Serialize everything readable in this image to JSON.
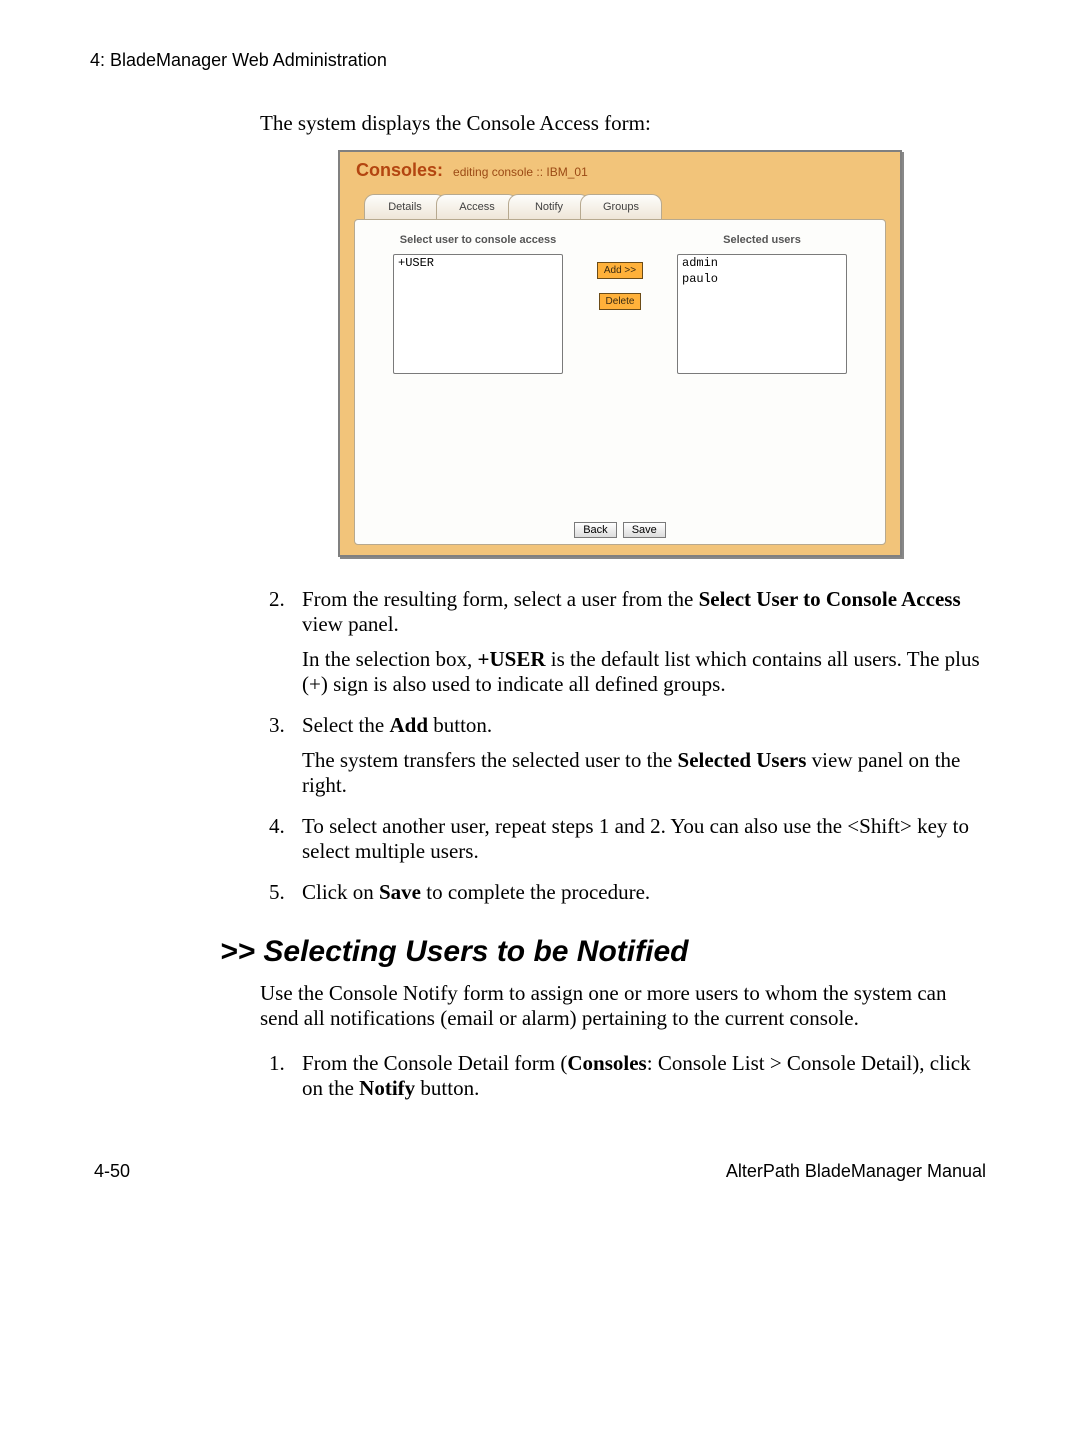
{
  "header": {
    "running": "4: BladeManager Web Administration"
  },
  "intro_line": "The system displays the Console Access form:",
  "card": {
    "title": "Consoles:",
    "subtitle": "editing console  ::  IBM_01",
    "tabs": [
      "Details",
      "Access",
      "Notify",
      "Groups"
    ],
    "left_heading": "Select user to console access",
    "right_heading": "Selected users",
    "left_options": [
      "+USER"
    ],
    "right_options": [
      "admin",
      "paulo"
    ],
    "btn_add": "Add >>",
    "btn_delete": "Delete",
    "btn_back": "Back",
    "btn_save": "Save"
  },
  "steps_a": [
    {
      "n": "2.",
      "main_pre": "From the resulting form, select a user from the ",
      "main_bold": "Select User to Console Access",
      "main_post": " view panel.",
      "sub_pre": "In the selection box, ",
      "sub_bold": "+USER",
      "sub_post": " is the default list which contains all users. The plus (+) sign is also used to indicate all defined groups."
    },
    {
      "n": "3.",
      "main_pre": "Select the ",
      "main_bold": "Add",
      "main_post": " button.",
      "sub_pre": "The system transfers the selected user to the ",
      "sub_bold": "Selected Users",
      "sub_post": " view panel on the right."
    },
    {
      "n": "4.",
      "main_pre": "To select another user, repeat steps 1 and 2. You can also use the <Shift> key to select multiple users.",
      "main_bold": "",
      "main_post": ""
    },
    {
      "n": "5.",
      "main_pre": "Click on ",
      "main_bold": "Save",
      "main_post": " to complete the procedure."
    }
  ],
  "section": {
    "chev": ">> ",
    "title": "Selecting Users to be Notified",
    "para": "Use the Console Notify form to assign one or more users to whom the system can send all notifications (email or alarm) pertaining to the current console."
  },
  "steps_b": [
    {
      "n": "1.",
      "pre": "From the Console Detail form (",
      "bold1": "Consoles",
      "mid": ": Console List > Console Detail), click on the ",
      "bold2": "Notify",
      "post": " button."
    }
  ],
  "footer": {
    "left": "4-50",
    "right": "AlterPath BladeManager Manual"
  }
}
